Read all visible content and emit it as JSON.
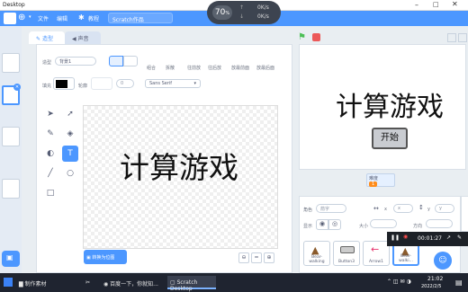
{
  "window": {
    "title": "Desktop"
  },
  "menu": {
    "file": "文件",
    "edit": "编辑",
    "tutorials": "教程",
    "project_title": "Scratch作品"
  },
  "timer": {
    "value": "70",
    "unit": "%",
    "up_rate": "0K/s",
    "down_rate": "0K/s"
  },
  "tabs": {
    "costumes": "造型",
    "sounds": "声音"
  },
  "paint": {
    "costume_label": "造型",
    "costume_name": "背景1",
    "group": "组合",
    "ungroup": "拆散",
    "forward": "往前放",
    "backward": "往后放",
    "front": "放最前面",
    "back": "放最后面",
    "fill_label": "填充",
    "outline_label": "轮廓",
    "outline_size": "0",
    "font": "Sans Serif",
    "canvas_text": "计算游戏",
    "convert_button": "转换为位图",
    "zoom_reset": "="
  },
  "stage": {
    "title": "计算游戏",
    "start_button": "开始",
    "monitor_label": "难度",
    "monitor_value": "1"
  },
  "sprite_info": {
    "sprite_label": "角色",
    "sprite_name": "箭字",
    "x_label": "x",
    "x_value": "x",
    "y_label": "y",
    "y_value": "y",
    "show_label": "显示",
    "size_label": "大小",
    "direction_label": "方向"
  },
  "sprites": [
    {
      "name": "Bear-walking"
    },
    {
      "name": "Button3"
    },
    {
      "name": "Arrow1"
    },
    {
      "name": "Bear-walki..."
    }
  ],
  "recorder": {
    "elapsed": "00:01:27"
  },
  "taskbar": {
    "app1": "制作素材",
    "app2": "百度一下，你就知...",
    "app3": "Scratch Desktop",
    "time": "21:02",
    "date": "2022/2/5"
  },
  "colors": {
    "accent": "#4c97ff",
    "taskbar": "#1f2430"
  }
}
